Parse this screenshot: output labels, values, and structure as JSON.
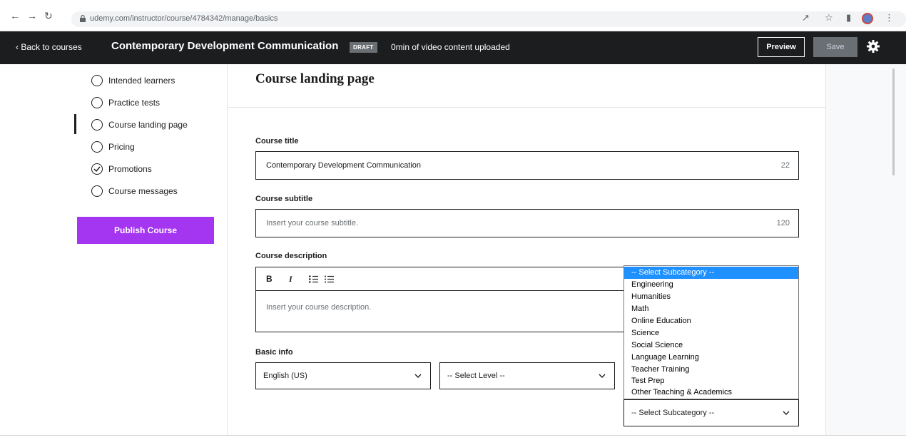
{
  "browser": {
    "url": "udemy.com/instructor/course/4784342/manage/basics"
  },
  "header": {
    "back_label": "Back to courses",
    "course_title": "Contemporary Development Communication",
    "draft_badge": "DRAFT",
    "upload_status": "0min of video content uploaded",
    "preview_label": "Preview",
    "save_label": "Save"
  },
  "sidebar": {
    "items": [
      {
        "label": "Intended learners",
        "checked": false
      },
      {
        "label": "Practice tests",
        "checked": false
      },
      {
        "label": "Course landing page",
        "checked": false,
        "active": true
      },
      {
        "label": "Pricing",
        "checked": false
      },
      {
        "label": "Promotions",
        "checked": true
      },
      {
        "label": "Course messages",
        "checked": false
      }
    ],
    "publish_label": "Publish Course"
  },
  "main": {
    "page_title": "Course landing page",
    "course_title": {
      "label": "Course title",
      "value": "Contemporary Development Communication",
      "remaining": "22"
    },
    "course_subtitle": {
      "label": "Course subtitle",
      "placeholder": "Insert your course subtitle.",
      "remaining": "120"
    },
    "course_description": {
      "label": "Course description",
      "toolbar": [
        "B",
        "I",
        "ordered-list",
        "bulleted-list"
      ],
      "placeholder": "Insert your course description."
    },
    "basic_info": {
      "label": "Basic info",
      "language": "English (US)",
      "level": "-- Select Level --",
      "subcategory": "-- Select Subcategory --"
    }
  },
  "subcategory_dropdown": {
    "options": [
      "-- Select Subcategory --",
      "Engineering",
      "Humanities",
      "Math",
      "Online Education",
      "Science",
      "Social Science",
      "Language Learning",
      "Teacher Training",
      "Test Prep",
      "Other Teaching & Academics"
    ],
    "highlighted": "-- Select Subcategory --"
  },
  "colors": {
    "header_bg": "#1c1d1f",
    "publish": "#a435f0",
    "highlight": "#1e90ff"
  }
}
